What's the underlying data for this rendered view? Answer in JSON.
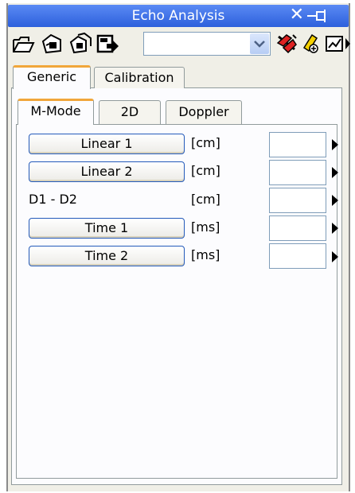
{
  "window": {
    "title": "Echo Analysis"
  },
  "toolbar": {
    "combo_value": "",
    "icons": [
      "open-folder-icon",
      "save-icon",
      "copy-icon",
      "export-icon",
      "combo-dropdown-icon",
      "delete-icon",
      "highlighter-icon",
      "report-icon",
      "more-icon"
    ]
  },
  "tabs": [
    {
      "label": "Generic",
      "active": true
    },
    {
      "label": "Calibration",
      "active": false
    }
  ],
  "subtabs": [
    {
      "label": "M-Mode",
      "active": true
    },
    {
      "label": "2D",
      "active": false
    },
    {
      "label": "Doppler",
      "active": false
    }
  ],
  "measurements": [
    {
      "label": "Linear 1",
      "unit": "[cm]",
      "value": "",
      "button": true
    },
    {
      "label": "Linear 2",
      "unit": "[cm]",
      "value": "",
      "button": true
    },
    {
      "label": "D1 - D2",
      "unit": "[cm]",
      "value": "",
      "button": false
    },
    {
      "label": "Time 1",
      "unit": "[ms]",
      "value": "",
      "button": true
    },
    {
      "label": "Time 2",
      "unit": "[ms]",
      "value": "",
      "button": true
    }
  ],
  "colors": {
    "title_bar": "#3d6fe6",
    "active_tab_accent": "#f1a63a",
    "button_border": "#245aba"
  }
}
